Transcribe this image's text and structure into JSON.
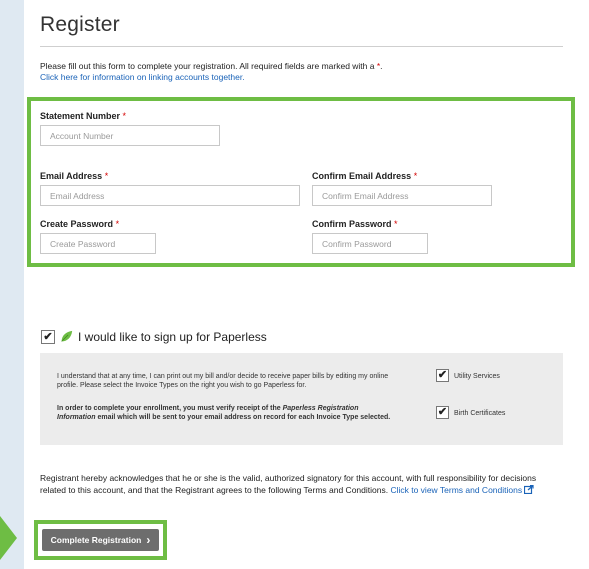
{
  "header": {
    "title": "Register"
  },
  "intro": {
    "text": "Please fill out this form to complete your registration. All required fields are marked with a",
    "required_marker": "*",
    "period": ".",
    "link_text": "Click here for information on linking accounts together."
  },
  "form": {
    "statement_number": {
      "label": "Statement Number",
      "placeholder": "Account Number"
    },
    "email": {
      "label": "Email Address",
      "placeholder": "Email Address"
    },
    "confirm_email": {
      "label": "Confirm Email Address",
      "placeholder": "Confirm Email Address"
    },
    "password": {
      "label": "Create Password",
      "placeholder": "Create Password"
    },
    "confirm_password": {
      "label": "Confirm Password",
      "placeholder": "Confirm Password"
    },
    "required_marker": "*"
  },
  "paperless": {
    "checked": true,
    "label": "I would like to sign up for Paperless",
    "info_line1": "I understand that at any time, I can print out my bill and/or decide to receive paper bills by editing my online",
    "info_line2": "profile. Please select the Invoice Types on the right you wish to go Paperless for.",
    "verify_pre": "In order to complete your enrollment, you must verify receipt of the",
    "verify_italic1": "Paperless Registration",
    "verify_italic2": "Information",
    "verify_post": "email which will be sent to your email address on record for each Invoice Type selected.",
    "options": [
      {
        "label": "Utility Services",
        "checked": true
      },
      {
        "label": "Birth Certificates",
        "checked": true
      }
    ]
  },
  "terms": {
    "text": "Registrant hereby acknowledges that he or she is the valid, authorized signatory for this account, with full responsibility for decisions related to this account, and that the Registrant agrees to the following Terms and Conditions.",
    "link_text": "Click to view Terms and Conditions"
  },
  "submit": {
    "label": "Complete Registration",
    "chevron": "›"
  },
  "colors": {
    "highlight_green": "#6ebd44",
    "link_blue": "#1a63b8",
    "required_red": "#d40000",
    "button_gray": "#6d6d6d"
  }
}
